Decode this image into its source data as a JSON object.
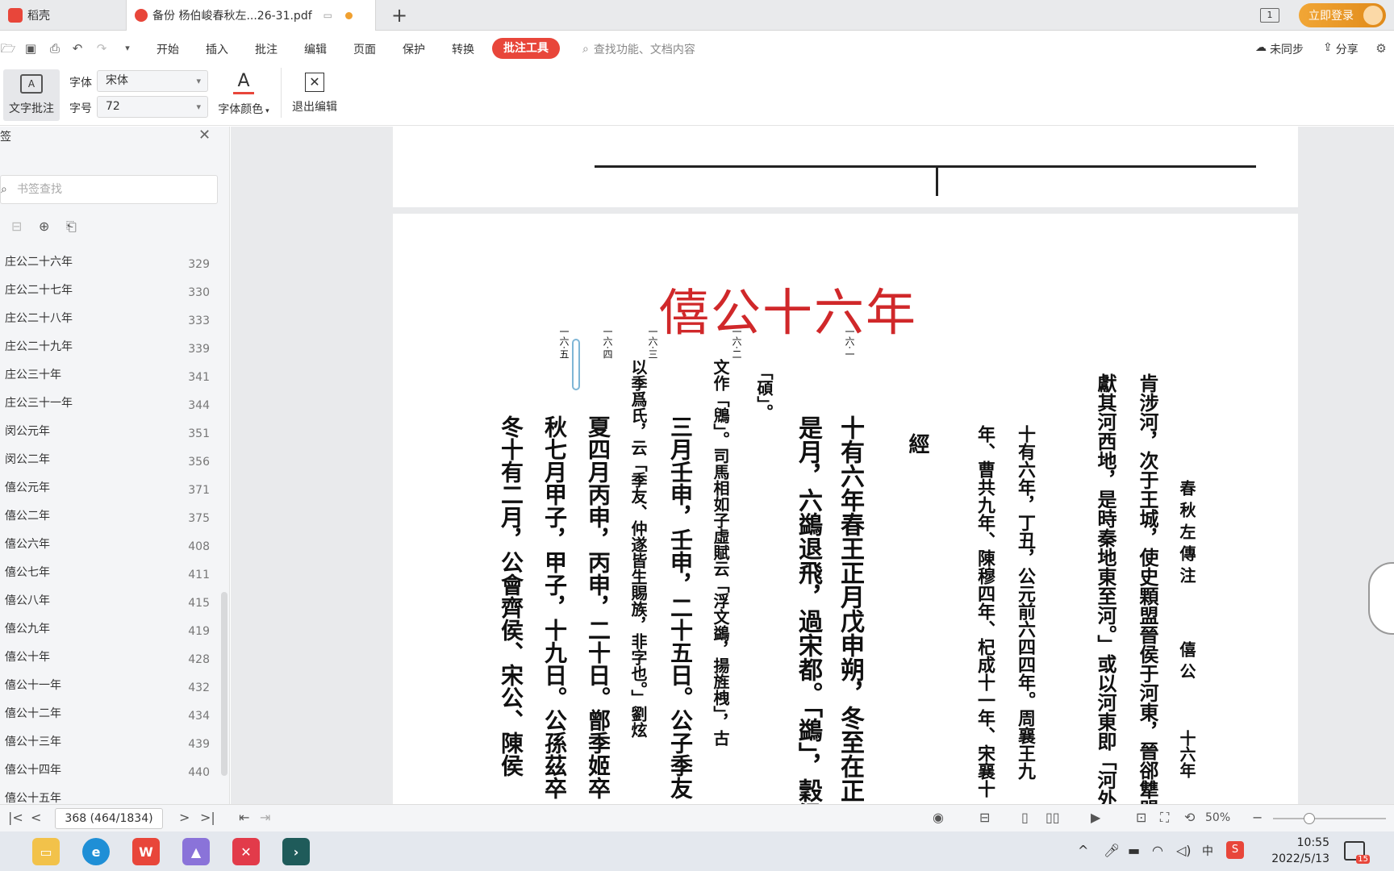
{
  "tabs": {
    "home_label": "稻壳",
    "doc_label": "备份 杨伯峻春秋左...26-31.pdf",
    "new_tab_symbol": "+",
    "login_label": "立即登录",
    "page_counter": "1"
  },
  "menubar": {
    "items": [
      "开始",
      "插入",
      "批注",
      "编辑",
      "页面",
      "保护",
      "转换"
    ],
    "active_item": "批注工具",
    "search_placeholder": "查找功能、文档内容",
    "sync_label": "未同步",
    "share_label": "分享"
  },
  "toolbar": {
    "text_annot_label": "文字批注",
    "font_label": "字体",
    "font_value": "宋体",
    "size_label": "字号",
    "size_value": "72",
    "font_color_label": "字体颜色",
    "exit_edit_label": "退出编辑",
    "accent_color": "#e8463a"
  },
  "sidebar": {
    "search_placeholder": "书签查找",
    "items": [
      {
        "name": "庄公二十六年",
        "page": "329"
      },
      {
        "name": "庄公二十七年",
        "page": "330"
      },
      {
        "name": "庄公二十八年",
        "page": "333"
      },
      {
        "name": "庄公二十九年",
        "page": "339"
      },
      {
        "name": "庄公三十年",
        "page": "341"
      },
      {
        "name": "庄公三十一年",
        "page": "344"
      },
      {
        "name": "闵公元年",
        "page": "351"
      },
      {
        "name": "闵公二年",
        "page": "356"
      },
      {
        "name": "僖公元年",
        "page": "371"
      },
      {
        "name": "僖公二年",
        "page": "375"
      },
      {
        "name": "僖公六年",
        "page": "408"
      },
      {
        "name": "僖公七年",
        "page": "411"
      },
      {
        "name": "僖公八年",
        "page": "415"
      },
      {
        "name": "僖公九年",
        "page": "419"
      },
      {
        "name": "僖公十年",
        "page": "428"
      },
      {
        "name": "僖公十一年",
        "page": "432"
      },
      {
        "name": "僖公十二年",
        "page": "434"
      },
      {
        "name": "僖公十三年",
        "page": "439"
      },
      {
        "name": "僖公十四年",
        "page": "440"
      },
      {
        "name": "僖公十五年",
        "page": ""
      }
    ]
  },
  "document": {
    "title": "僖公十六年",
    "title_color": "#d0282a",
    "section_label": "經",
    "header_cols": [
      "春 秋 左 傳 注",
      "僖 公",
      "十六年"
    ],
    "numbers": [
      "一六·一",
      "一六·二",
      "一六·三",
      "一六·四",
      "一六·五"
    ],
    "prev_cols": [
      "肯涉河，次于王城，使史顆盟晉侯于河東，晉郤犨盟",
      "獻其河西地，是時秦地東至河。」或以河東即「河外列"
    ],
    "year_cols": [
      "十有六年，丁丑，公元前六四四年。周襄王九",
      "年、曹共九年、陳穆四年、杞成十一年、宋襄十"
    ],
    "body_cols": [
      "十有六年春王正月戊申朔，冬至在正",
      "是月，六鷁退飛，過宋都。「鷁」，穀梁",
      "「碩」。",
      "文作「鶂」。司馬相如子虛賦云「浮文鷁，揚旌栧」，古",
      "三月壬申，壬申，二十五日。公子季友",
      "以季爲氏，云「季友、仲遂皆生賜族，非字也。」劉炫",
      "夏四月丙申，丙申，二十日。鄫季姬卒",
      "秋七月甲子，甲子，十九日。公孫茲卒",
      "冬十有二月，公會齊侯、宋公、陳侯"
    ]
  },
  "statusbar": {
    "page_display": "368 (464/1834)",
    "zoom": "50%"
  },
  "taskbar": {
    "time": "10:55",
    "date": "2022/5/13",
    "notification_count": "15"
  }
}
